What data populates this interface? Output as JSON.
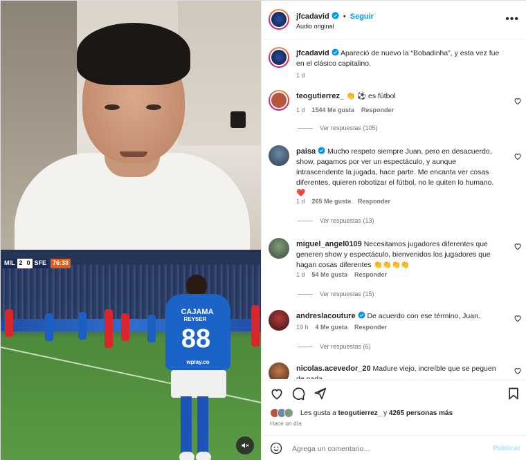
{
  "header": {
    "username": "jfcadavid",
    "separator": "•",
    "follow_label": "Seguir",
    "audio": "Audio original",
    "more_icon": "more-options-icon"
  },
  "scoreboard": {
    "home": "MIL",
    "home_score": "2",
    "away_score": "0",
    "away": "SFE",
    "time": "76:38"
  },
  "jersey": {
    "sponsor": "CAJAMA",
    "name": "REYSER",
    "number": "88",
    "brand": "wplay.co"
  },
  "caption": {
    "username": "jfcadavid",
    "text": "Apareció de nuevo la “Bobadinha”, y esta vez fue en el clásico capitalino.",
    "time": "1 d"
  },
  "comments": [
    {
      "username": "teogutierrez_",
      "text": "👏 ⚽ es fútbol",
      "time": "1 d",
      "likes": "1544 Me gusta",
      "reply": "Responder",
      "replies": "Ver respuestas (105)"
    },
    {
      "username": "paisa",
      "text": "Mucho respeto siempre Juan, pero en desacuerdo, show, pagamos por ver un espectáculo, y aunque intrascendente la jugada, hace parte. Me encanta ver cosas diferentes, quieren robotizar el fútbol, no le quiten lo humano. ❤️",
      "time": "1 d",
      "likes": "265 Me gusta",
      "reply": "Responder",
      "replies": "Ver respuestas (13)"
    },
    {
      "username": "miguel_angel0109",
      "text": "Necesitamos jugadores diferentes que generen show y espectáculo, bienvenidos los jugadores que hagan cosas diferentes 👏👏👏👏",
      "time": "1 d",
      "likes": "54 Me gusta",
      "reply": "Responder",
      "replies": "Ver respuestas (15)"
    },
    {
      "username": "andreslacouture",
      "text": "De acuerdo con ese término, Juan.",
      "time": "19 h",
      "likes": "4 Me gusta",
      "reply": "Responder",
      "replies": "Ver respuestas (6)"
    },
    {
      "username": "nicolas.acevedor_20",
      "text": "Madure viejo, increíble que se peguen de nada"
    }
  ],
  "likes": {
    "prefix": "Les gusta a",
    "user": "teogutierrez_",
    "middle": "y",
    "others": "4265 personas más"
  },
  "posted": "Hace un día",
  "add_comment": {
    "placeholder": "Agrega un comentario...",
    "publish": "Publicar"
  },
  "colors": {
    "accent": "#0095f6",
    "like_heart": "#ed4956",
    "muted_text": "#737373"
  }
}
